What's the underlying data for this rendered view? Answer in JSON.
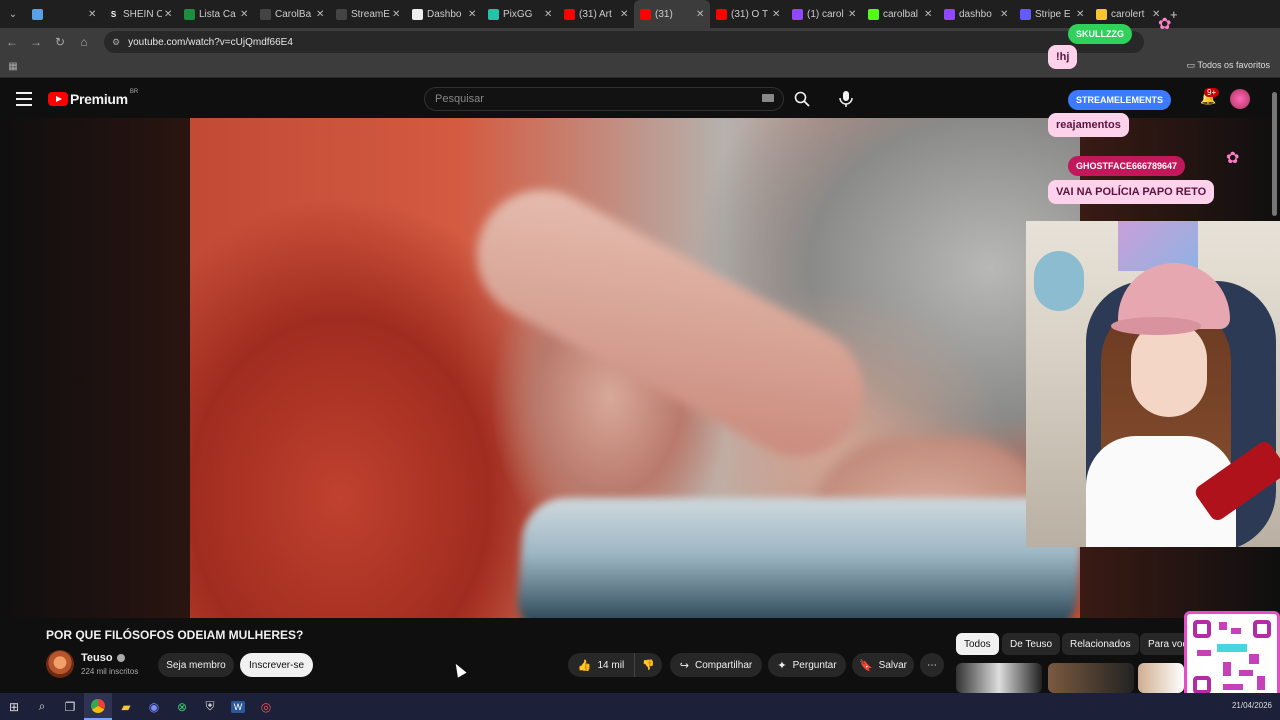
{
  "browser": {
    "tabs": [
      {
        "label": "",
        "color": "#5aa0e8",
        "icon": "gem-icon"
      },
      {
        "label": "SHEIN C",
        "color": "#222222",
        "icon": "S"
      },
      {
        "label": "Lista Ca",
        "color": "#1e8e3e",
        "icon": "sheet-icon"
      },
      {
        "label": "CarolBa",
        "color": "#444444",
        "icon": "doc-icon"
      },
      {
        "label": "StreamE",
        "color": "#444444",
        "icon": "streamelements-icon"
      },
      {
        "label": "Dashbo",
        "color": "#eeeeee",
        "icon": "globe-icon"
      },
      {
        "label": "PixGG",
        "color": "#22c3a6",
        "icon": "pixgg-icon"
      },
      {
        "label": "(31) Art",
        "color": "#ff0000",
        "icon": "youtube-icon"
      },
      {
        "label": "(31)",
        "color": "#ff0000",
        "icon": "youtube-icon",
        "active": true
      },
      {
        "label": "(31) O T",
        "color": "#ff0000",
        "icon": "youtube-icon"
      },
      {
        "label": "(1) carol",
        "color": "#9146ff",
        "icon": "twitch-icon"
      },
      {
        "label": "carolbal",
        "color": "#53fc18",
        "icon": "kick-icon"
      },
      {
        "label": "dashbo",
        "color": "#9146ff",
        "icon": "dashboard-icon"
      },
      {
        "label": "Stripe E",
        "color": "#635bff",
        "icon": "stripe-icon"
      },
      {
        "label": "carolert",
        "color": "#f7c531",
        "icon": "alert-icon"
      }
    ],
    "url": "youtube.com/watch?v=cUjQmdf66E4",
    "bookmarks_right": "Todos os favoritos"
  },
  "youtube": {
    "logo_text": "Premium",
    "logo_region": "BR",
    "search_placeholder": "Pesquisar",
    "video_title": "POR QUE FILÓSOFOS ODEIAM MULHERES?",
    "channel": {
      "name": "Teuso",
      "subscribers": "224 mil inscritos"
    },
    "buttons": {
      "member": "Seja membro",
      "subscribe": "Inscrever-se",
      "likes": "14 mil",
      "share": "Compartilhar",
      "ask": "Perguntar",
      "save": "Salvar"
    },
    "chips": [
      "Todos",
      "De Teuso",
      "Relacionados",
      "Para voc"
    ]
  },
  "overlay": {
    "chat": [
      {
        "user": "SKULLZZG",
        "message": "!hj",
        "tag_color": "#2fd15a"
      },
      {
        "user": "STREAMELEMENTS",
        "message": "reajamentos",
        "tag_color": "#3a7bff"
      },
      {
        "user": "GHOSTFACE666789647",
        "message": "VAI NA POLÍCIA PAPO RETO",
        "tag_color": "#c2185b"
      }
    ],
    "notif_badge": "9+"
  },
  "taskbar": {
    "date": "21/04/2026"
  },
  "colors": {
    "youtube_red": "#ff0000",
    "overlay_pink": "#ffd2ec",
    "qr_border": "#e84cc8"
  }
}
